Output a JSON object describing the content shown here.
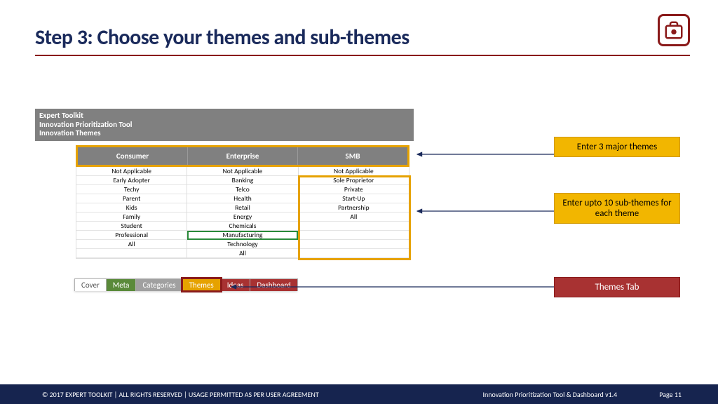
{
  "title": "Step 3: Choose your themes and sub-themes",
  "panel_header": {
    "line1": "Expert Toolkit",
    "line2": "Innovation Prioritization Tool",
    "line3": "Innovation Themes"
  },
  "themes": {
    "headers": [
      "Consumer",
      "Enterprise",
      "SMB"
    ],
    "columns": [
      [
        "Not Applicable",
        "Early Adopter",
        "Techy",
        "Parent",
        "Kids",
        "Family",
        "Student",
        "Professional",
        "All",
        ""
      ],
      [
        "Not Applicable",
        "Banking",
        "Telco",
        "Health",
        "Retail",
        "Energy",
        "Chemicals",
        "Manufacturing",
        "Technology",
        "All"
      ],
      [
        "Not Applicable",
        "Sole Proprietor",
        "Private",
        "Start-Up",
        "Partnership",
        "All",
        "",
        "",
        "",
        ""
      ]
    ],
    "selected": {
      "col": 1,
      "row": 7
    }
  },
  "tabs": [
    {
      "label": "Cover",
      "color": "white"
    },
    {
      "label": "Meta",
      "color": "green"
    },
    {
      "label": "Categories",
      "color": "grey"
    },
    {
      "label": "Themes",
      "color": "gold",
      "highlighted": true
    },
    {
      "label": "Ideas",
      "color": "red"
    },
    {
      "label": "Dashboard",
      "color": "red"
    }
  ],
  "callouts": {
    "themes_header": "Enter 3 major themes",
    "subthemes": "Enter upto 10 sub-themes for each theme",
    "tab_label": "Themes Tab"
  },
  "footer": {
    "left": "© 2017 EXPERT TOOLKIT | ALL RIGHTS RESERVED | USAGE PERMITTED AS PER USER AGREEMENT",
    "product": "Innovation Prioritization Tool & Dashboard v1.4",
    "page": "Page 11"
  }
}
